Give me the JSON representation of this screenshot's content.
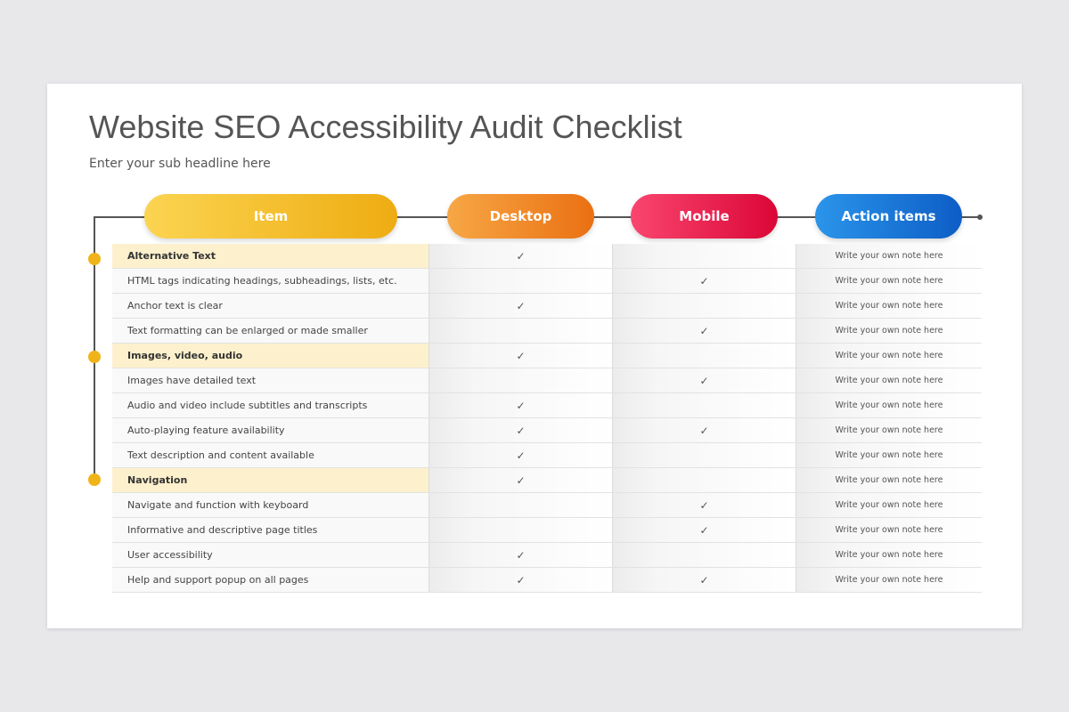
{
  "title": "Website SEO Accessibility Audit Checklist",
  "subtitle": "Enter your sub headline here",
  "headers": {
    "item": "Item",
    "desktop": "Desktop",
    "mobile": "Mobile",
    "action": "Action items"
  },
  "colors": {
    "accent_yellow": "#f0b418",
    "desktop_orange": "#ea7012",
    "mobile_red": "#db0636",
    "action_blue": "#0d5dc6",
    "section_highlight": "#fdf0cc"
  },
  "check_symbol": "✓",
  "rows": [
    {
      "item": "Alternative Text",
      "section": true,
      "desktop": "✓",
      "mobile": "",
      "action": "Write your own note here"
    },
    {
      "item": "HTML tags indicating headings, subheadings, lists, etc.",
      "section": false,
      "desktop": "",
      "mobile": "✓",
      "action": "Write your own note here"
    },
    {
      "item": "Anchor text is clear",
      "section": false,
      "desktop": "✓",
      "mobile": "",
      "action": "Write your own note here"
    },
    {
      "item": "Text formatting can be enlarged or made smaller",
      "section": false,
      "desktop": "",
      "mobile": "✓",
      "action": "Write your own note here"
    },
    {
      "item": "Images, video, audio",
      "section": true,
      "desktop": "✓",
      "mobile": "",
      "action": "Write your own note here"
    },
    {
      "item": "Images have detailed text",
      "section": false,
      "desktop": "",
      "mobile": "✓",
      "action": "Write your own note here"
    },
    {
      "item": "Audio and video include subtitles and transcripts",
      "section": false,
      "desktop": "✓",
      "mobile": "",
      "action": "Write your own note here"
    },
    {
      "item": "Auto-playing feature availability",
      "section": false,
      "desktop": "✓",
      "mobile": "✓",
      "action": "Write your own note here"
    },
    {
      "item": "Text description and content available",
      "section": false,
      "desktop": "✓",
      "mobile": "",
      "action": "Write your own note here"
    },
    {
      "item": "Navigation",
      "section": true,
      "desktop": "✓",
      "mobile": "",
      "action": "Write your own note here"
    },
    {
      "item": "Navigate and function with keyboard",
      "section": false,
      "desktop": "",
      "mobile": "✓",
      "action": "Write your own note here"
    },
    {
      "item": "Informative and descriptive page titles",
      "section": false,
      "desktop": "",
      "mobile": "✓",
      "action": "Write your own note here"
    },
    {
      "item": "User accessibility",
      "section": false,
      "desktop": "✓",
      "mobile": "",
      "action": "Write your own note here"
    },
    {
      "item": "Help and support popup on all pages",
      "section": false,
      "desktop": "✓",
      "mobile": "✓",
      "action": "Write your own note here"
    }
  ]
}
